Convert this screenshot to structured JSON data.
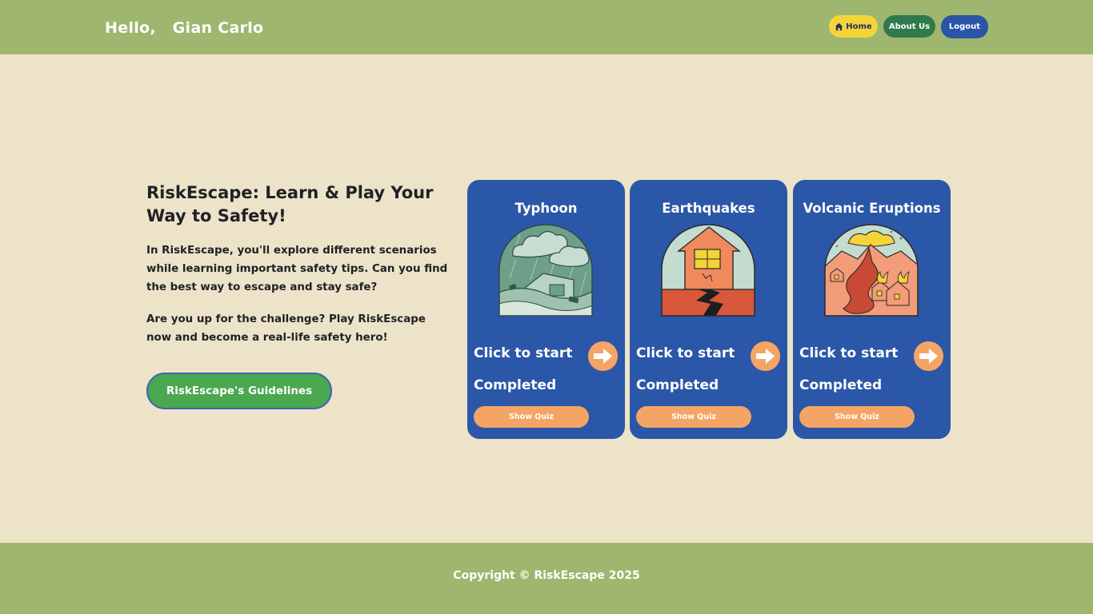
{
  "header": {
    "greeting": "Hello,   Gian Carlo",
    "nav": {
      "home_label": "Home",
      "about_label": "About Us",
      "logout_label": "Logout"
    }
  },
  "intro": {
    "title": "RiskEscape: Learn & Play Your Way to Safety!",
    "paragraph1": "In RiskEscape, you'll explore different scenarios while learning important safety tips. Can you find the best way to escape and stay safe?",
    "paragraph2": "Are you up for the challenge? Play RiskEscape now and become a real-life safety hero!",
    "guidelines_button": "RiskEscape's Guidelines"
  },
  "cards": [
    {
      "title": "Typhoon",
      "start_label": "Click to start",
      "status": "Completed",
      "quiz_label": "Show Quiz",
      "icon": "typhoon-illustration"
    },
    {
      "title": "Earthquakes",
      "start_label": "Click to start",
      "status": "Completed",
      "quiz_label": "Show Quiz",
      "icon": "earthquake-illustration"
    },
    {
      "title": "Volcanic Eruptions",
      "start_label": "Click to start",
      "status": "Completed",
      "quiz_label": "Show Quiz",
      "icon": "volcano-illustration"
    }
  ],
  "footer": {
    "copyright": "Copyright © RiskEscape 2025"
  },
  "colors": {
    "header_bg": "#9fb66e",
    "page_bg": "#ede3c8",
    "card_bg": "#2b57a8",
    "accent_orange": "#f4a565",
    "home_yellow": "#f5d43a",
    "about_green": "#2f7a4c",
    "logout_blue": "#2a54a6",
    "guidelines_green": "#4aa850"
  }
}
